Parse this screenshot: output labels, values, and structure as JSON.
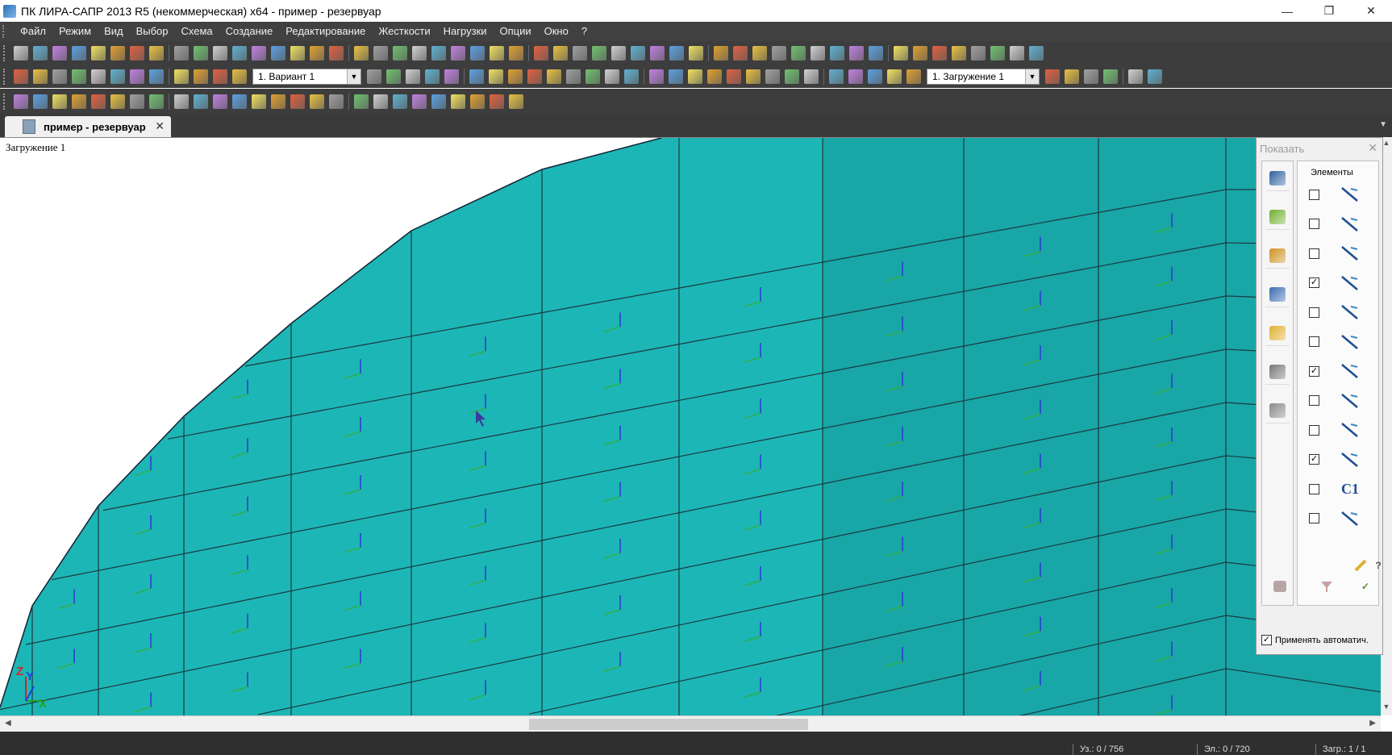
{
  "window": {
    "title": "ПК ЛИРА-САПР  2013 R5 (некоммерческая) x64 - пример - резервуар",
    "controls": [
      "—",
      "❐",
      "✕"
    ]
  },
  "menu": [
    "Файл",
    "Режим",
    "Вид",
    "Выбор",
    "Схема",
    "Создание",
    "Редактирование",
    "Жесткости",
    "Нагрузки",
    "Опции",
    "Окно",
    "?"
  ],
  "toolbar": {
    "variant_combo": "1. Вариант 1",
    "loadcase_combo": "1. Загружение 1"
  },
  "document_tab": {
    "label": "пример - резервуар",
    "close": "✕"
  },
  "canvas": {
    "loadcase_label": "Загружение 1",
    "mesh_color": "#19a6a6",
    "mesh_color_light": "#21c2c2",
    "axis": {
      "z": "Z",
      "y": "Y",
      "x": "X"
    }
  },
  "panel": {
    "title": "Показать",
    "group_label": "Элементы",
    "rows": [
      {
        "checked": false,
        "icon": "bar-element-icon"
      },
      {
        "checked": false,
        "icon": "bar-section-icon"
      },
      {
        "checked": false,
        "icon": "plate-element-icon"
      },
      {
        "checked": true,
        "icon": "local-axes-icon"
      },
      {
        "checked": false,
        "icon": "hinge-icon"
      },
      {
        "checked": false,
        "icon": "orientation-icon"
      },
      {
        "checked": true,
        "icon": "plate-axes-icon"
      },
      {
        "checked": false,
        "icon": "rigid-insert-icon"
      },
      {
        "checked": false,
        "icon": "solid-element-icon"
      },
      {
        "checked": true,
        "icon": "element-type-icon"
      },
      {
        "checked": false,
        "icon": "stiffness-type-icon",
        "text": "C1"
      },
      {
        "checked": false,
        "icon": "element-number-icon"
      }
    ],
    "apply_auto_label": "Применять автоматич.",
    "apply_auto_checked": true
  },
  "status": {
    "nodes": "Уз.: 0 / 756",
    "elements": "Эл.: 0 / 720",
    "loads": "Загр.: 1 / 1"
  }
}
